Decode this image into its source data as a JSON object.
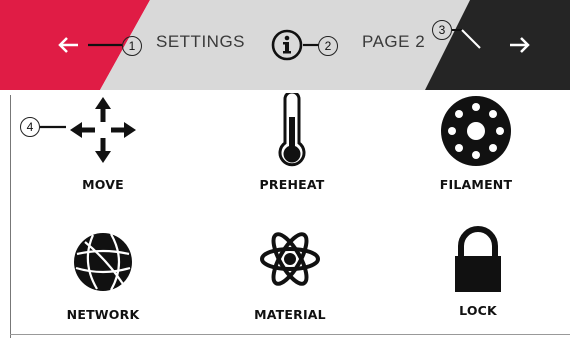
{
  "header": {
    "title": "SETTINGS",
    "page_label": "PAGE 2",
    "back_icon": "arrow-left-icon",
    "next_icon": "arrow-right-icon",
    "info_icon": "info-icon",
    "colors": {
      "back_bg": "#e01c45",
      "bar_bg": "#d8d8d8",
      "next_bg": "#252525"
    }
  },
  "callouts": [
    "1",
    "2",
    "3",
    "4"
  ],
  "tiles": [
    {
      "label": "MOVE",
      "icon": "move-arrows-icon"
    },
    {
      "label": "PREHEAT",
      "icon": "thermometer-icon"
    },
    {
      "label": "FILAMENT",
      "icon": "filament-spool-icon"
    },
    {
      "label": "NETWORK",
      "icon": "globe-network-icon"
    },
    {
      "label": "MATERIAL",
      "icon": "atom-icon"
    },
    {
      "label": "LOCK",
      "icon": "padlock-icon"
    }
  ]
}
